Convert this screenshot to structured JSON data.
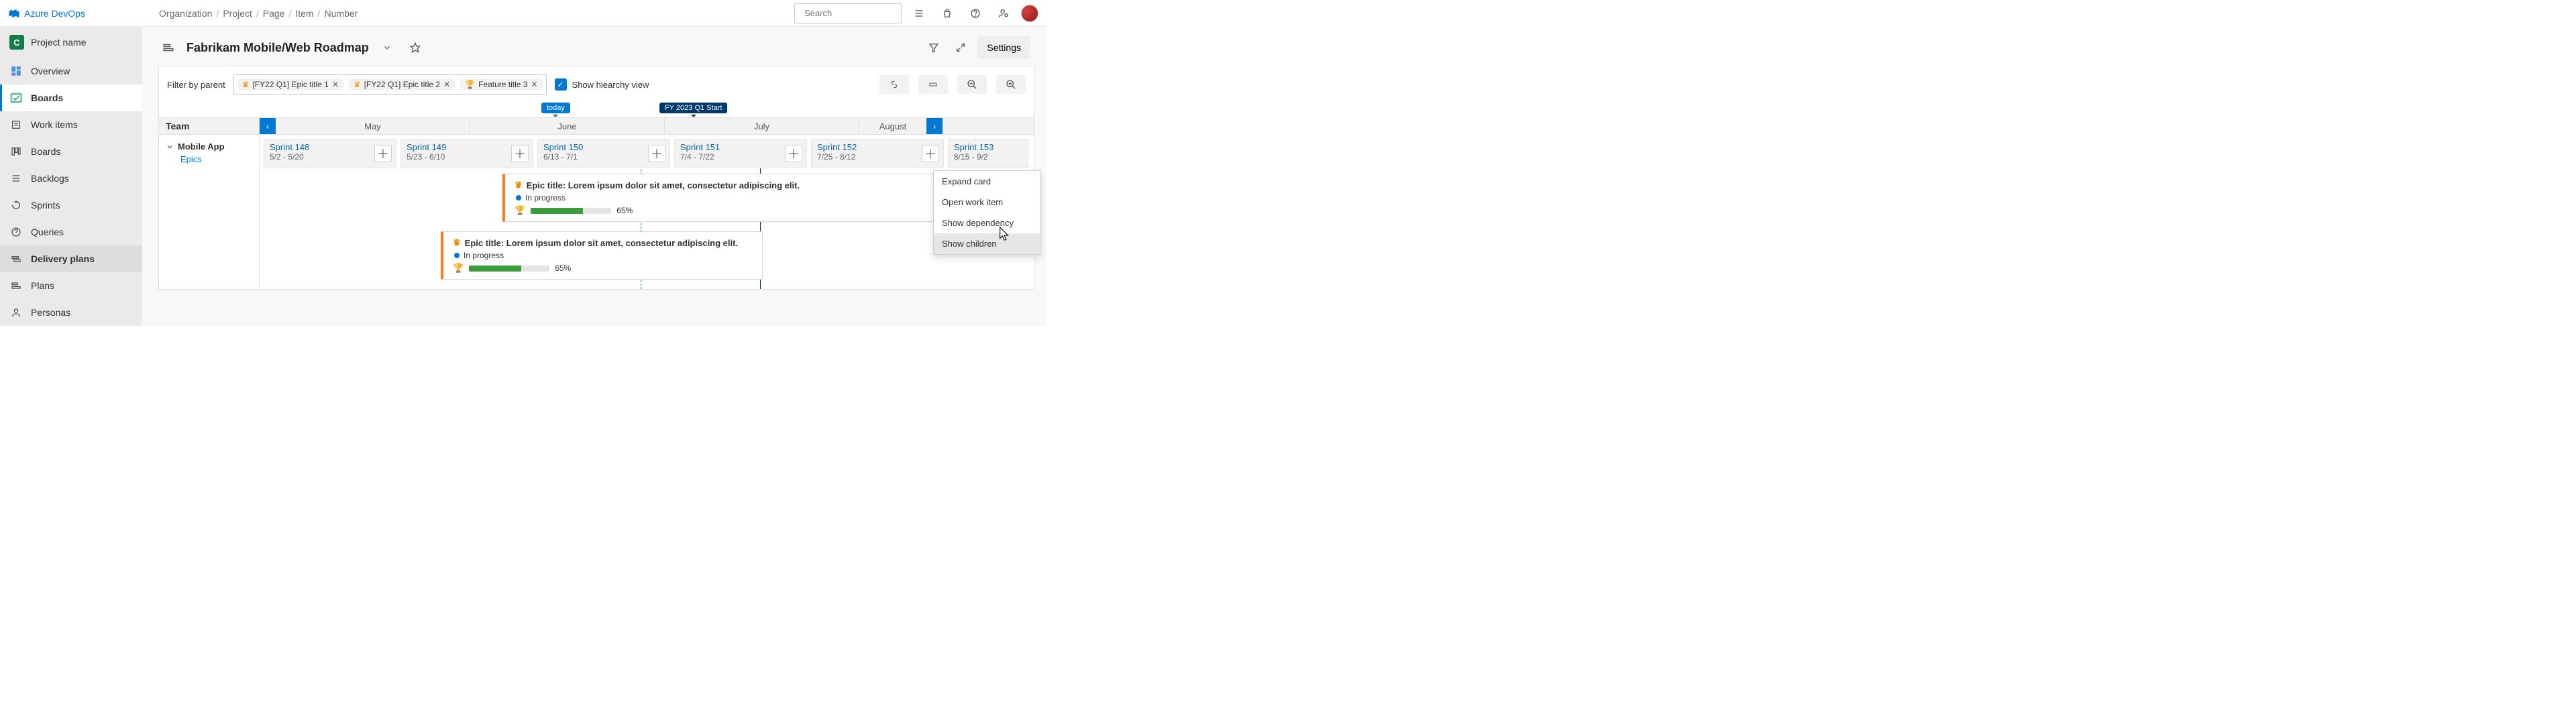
{
  "brand": "Azure DevOps",
  "breadcrumbs": [
    "Organization",
    "Project",
    "Page",
    "Item",
    "Number"
  ],
  "search_placeholder": "Search",
  "project": {
    "letter": "C",
    "name": "Project name"
  },
  "sidebar": {
    "overview": "Overview",
    "boards": "Boards",
    "work_items": "Work items",
    "boards_sub": "Boards",
    "backlogs": "Backlogs",
    "sprints": "Sprints",
    "queries": "Queries",
    "delivery_plans": "Delivery plans",
    "plans": "Plans",
    "personas": "Personas"
  },
  "page_title": "Fabrikam Mobile/Web Roadmap",
  "settings_label": "Settings",
  "filter_label": "Filter by parent",
  "filter_pills": [
    {
      "icon": "crown",
      "label": "[FY22 Q1] Epic title 1"
    },
    {
      "icon": "crown",
      "label": "[FY22 Q1] Epic title 2"
    },
    {
      "icon": "trophy",
      "label": "Feature title 3"
    }
  ],
  "hierarchy_label": "Show hiearchy view",
  "team_header": "Team",
  "months": [
    "May",
    "June",
    "July",
    "August"
  ],
  "today_label": "today",
  "milestone_label": "FY 2023 Q1 Start",
  "team": {
    "name": "Mobile App",
    "level": "Epics"
  },
  "sprints": [
    {
      "name": "Sprint 148",
      "dates": "5/2 - 5/20"
    },
    {
      "name": "Sprint 149",
      "dates": "5/23 - 6/10"
    },
    {
      "name": "Sprint 150",
      "dates": "6/13 - 7/1"
    },
    {
      "name": "Sprint 151",
      "dates": "7/4 - 7/22"
    },
    {
      "name": "Sprint 152",
      "dates": "7/25 - 8/12"
    },
    {
      "name": "Sprint 153",
      "dates": "8/15 - 9/2"
    }
  ],
  "cards": [
    {
      "title": "Epic title: Lorem ipsum dolor sit amet, consectetur adipiscing elit.",
      "status": "In progress",
      "percent": "65%"
    },
    {
      "title": "Epic title: Lorem ipsum dolor sit amet, consectetur adipiscing elit.",
      "status": "In progress",
      "percent": "65%"
    }
  ],
  "context_menu": {
    "expand": "Expand card",
    "open": "Open work item",
    "dependency": "Show dependency",
    "children": "Show children"
  }
}
